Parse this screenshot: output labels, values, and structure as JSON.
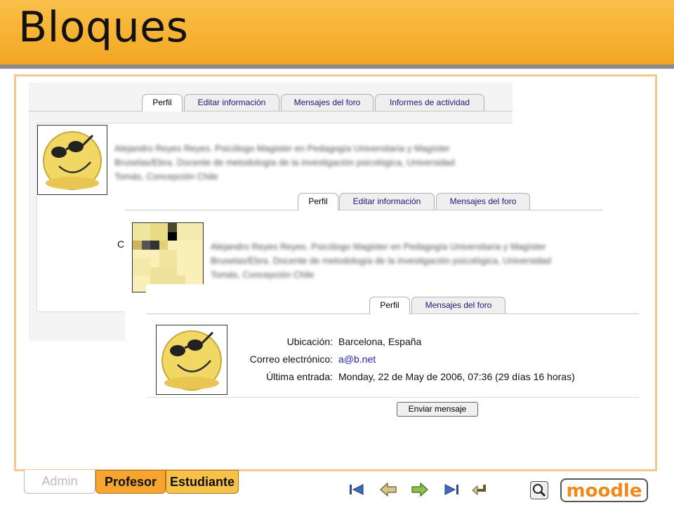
{
  "slide": {
    "title": "Bloques"
  },
  "shot1": {
    "tabs": [
      "Perfil",
      "Editar información",
      "Mensajes del foro",
      "Informes de actividad"
    ],
    "blurred_text": [
      "Alejandro Reyes Reyes. Psicólogo Magister en Pedagogía Universitaria y Magíster",
      "Bruselas/Ebra. Docente de metodología de la investigación psicológica, Universidad",
      "Tomás, Concepción Chile"
    ]
  },
  "shot2": {
    "tabs": [
      "Perfil",
      "Editar información",
      "Mensajes del foro"
    ],
    "blurred_text": [
      "Alejandro Reyes Reyes. Psicólogo Magister en Pedagogía Universitaria y Magíster",
      "Bruselas/Ebra. Docente de metodología de la investigación psicológica, Universidad",
      "Tomás, Concepción Chile"
    ],
    "left_char": "C"
  },
  "shot3": {
    "tabs": [
      "Perfil",
      "Mensajes del foro"
    ],
    "location_label": "Ubicación:",
    "location_value": "Barcelona, España",
    "email_label": "Correo electrónico:",
    "email_value": "a@b.net",
    "last_label": "Última entrada:",
    "last_value": "Monday, 22 de May de 2006, 07:36  (29 días 16 horas)",
    "send_button": "Enviar mensaje"
  },
  "roles": {
    "admin": "Admin",
    "profesor": "Profesor",
    "estudiante": "Estudiante"
  },
  "logo": {
    "text": "moodle"
  },
  "icons": [
    "first-slide-icon",
    "previous-slide-icon",
    "next-slide-icon",
    "last-slide-icon",
    "return-icon",
    "search-icon"
  ]
}
